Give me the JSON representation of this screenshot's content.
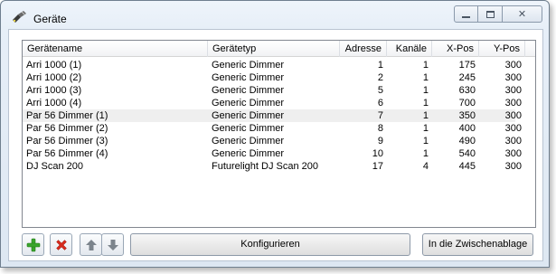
{
  "window": {
    "title": "Geräte",
    "minimize_icon": "minimize-icon",
    "maximize_icon": "maximize-icon",
    "close_icon": "close-icon",
    "app_icon": "dimmer-device-icon"
  },
  "table": {
    "columns": [
      "Gerätename",
      "Gerätetyp",
      "Adresse",
      "Kanäle",
      "X-Pos",
      "Y-Pos"
    ],
    "rows": [
      {
        "name": "Arri 1000 (1)",
        "type": "Generic Dimmer",
        "address": "1",
        "channels": "1",
        "x": "175",
        "y": "300"
      },
      {
        "name": "Arri 1000 (2)",
        "type": "Generic Dimmer",
        "address": "2",
        "channels": "1",
        "x": "245",
        "y": "300"
      },
      {
        "name": "Arri 1000 (3)",
        "type": "Generic Dimmer",
        "address": "5",
        "channels": "1",
        "x": "630",
        "y": "300"
      },
      {
        "name": "Arri 1000 (4)",
        "type": "Generic Dimmer",
        "address": "6",
        "channels": "1",
        "x": "700",
        "y": "300"
      },
      {
        "name": "Par 56 Dimmer (1)",
        "type": "Generic Dimmer",
        "address": "7",
        "channels": "1",
        "x": "350",
        "y": "300"
      },
      {
        "name": "Par 56 Dimmer (2)",
        "type": "Generic Dimmer",
        "address": "8",
        "channels": "1",
        "x": "400",
        "y": "300"
      },
      {
        "name": "Par 56 Dimmer (3)",
        "type": "Generic Dimmer",
        "address": "9",
        "channels": "1",
        "x": "490",
        "y": "300"
      },
      {
        "name": "Par 56 Dimmer (4)",
        "type": "Generic Dimmer",
        "address": "10",
        "channels": "1",
        "x": "540",
        "y": "300"
      },
      {
        "name": "DJ Scan 200",
        "type": "Futurelight DJ Scan 200",
        "address": "17",
        "channels": "4",
        "x": "445",
        "y": "300"
      }
    ],
    "selected_row": 4
  },
  "toolbar": {
    "add_icon": "plus-icon",
    "delete_icon": "x-icon",
    "up_icon": "arrow-up-icon",
    "down_icon": "arrow-down-icon",
    "configure_label": "Konfigurieren",
    "clipboard_label": "In die Zwischenablage"
  },
  "colors": {
    "add": "#3aa52d",
    "delete": "#d52a1c",
    "arrows": "#7c848c",
    "selected_row": "#efefef"
  }
}
